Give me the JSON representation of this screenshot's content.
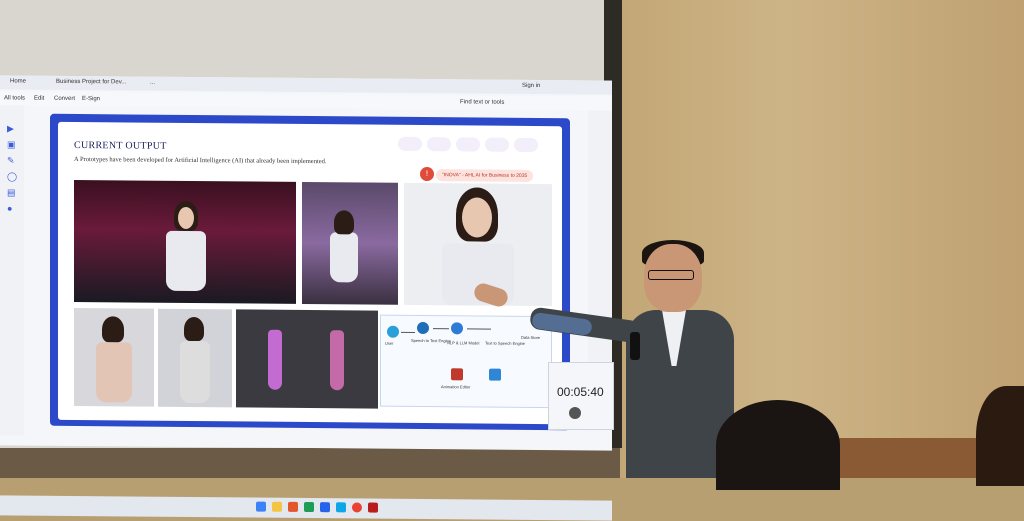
{
  "browser": {
    "tabs": [
      "Home",
      "Business Project for Dev...",
      "..."
    ],
    "menu": [
      "All tools",
      "Edit",
      "Convert",
      "E-Sign"
    ],
    "right_label": "Find text or tools",
    "sign_in": "Sign in"
  },
  "slide": {
    "title": "CURRENT OUTPUT",
    "subtitle": "A Prototypes have been developed for Artificial Intelligence (AI) that already been implemented.",
    "pill_text": "\"INOVA\" - AHL AI for Business to 2035",
    "logos": [
      "logo-1",
      "logo-2",
      "logo-3",
      "logo-4",
      "logo-5"
    ],
    "flow": {
      "nodes": [
        "User",
        "Speech to Text Engine",
        "NLP & LLM Model",
        "Text to Speech Engine",
        "Data Store",
        "Animation Editor"
      ]
    }
  },
  "timer": {
    "value": "00:05:40"
  },
  "colors": {
    "slide_border": "#2b49c8",
    "accent_red": "#e04b3b",
    "wall": "#c3a776",
    "jacket": "#3f4448"
  }
}
